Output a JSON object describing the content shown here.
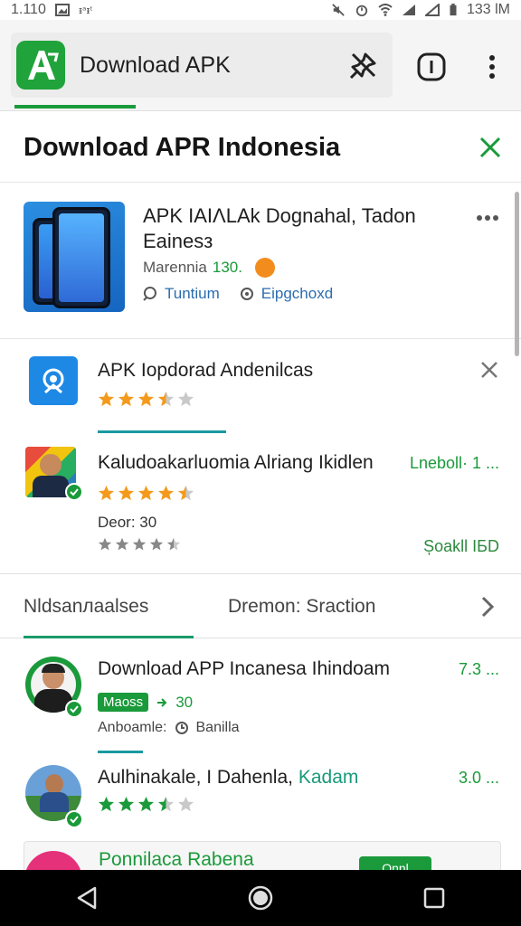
{
  "status_bar": {
    "time": "1.110",
    "right_text": "133 lM"
  },
  "app_bar": {
    "title": "Download APK"
  },
  "header": {
    "title": "Download APR Indonesia"
  },
  "featured": {
    "title": "APK ΙΑΙΛLAk Dognahal, Tadon Eainesз",
    "meta_label": "Marennia",
    "meta_value": "130.",
    "tag_1": "Tuntium",
    "tag_2": "Eipgchoхd"
  },
  "list_top": [
    {
      "title": "APK Iopdorad Andenilcas",
      "rating": 3.5
    },
    {
      "title": "Kaludoakarluomia Alriang Ikidlen",
      "right_text": "Lnebоll· 1 ...",
      "rating": 4.5,
      "sub_label": "Deor: 30",
      "rating_small": 4.5,
      "bottom_right": "Șoakll ІБD"
    }
  ],
  "tabs": {
    "tab_1": "Nldsanлaalses",
    "tab_2": "Dremon: Sraction"
  },
  "list_bottom": [
    {
      "title": "Download APP Incanesa Ihindoam",
      "right_text": "7.3 ...",
      "pill": "Maoss",
      "arrow_value": "30",
      "sub_label": "Anboamle:",
      "sub_value": "Banilla"
    },
    {
      "title_plain": "Aulhinakale, I Dahenla,",
      "title_green": "Kadam",
      "right_text": "3.0 ...",
      "rating": 3.5
    }
  ],
  "bottom_card": {
    "title": "Ponnilaca Rabena",
    "button": "Onnl"
  },
  "colors": {
    "accent": "#1a9a3a",
    "star": "#f39a1d",
    "link": "#2b6cb0"
  }
}
